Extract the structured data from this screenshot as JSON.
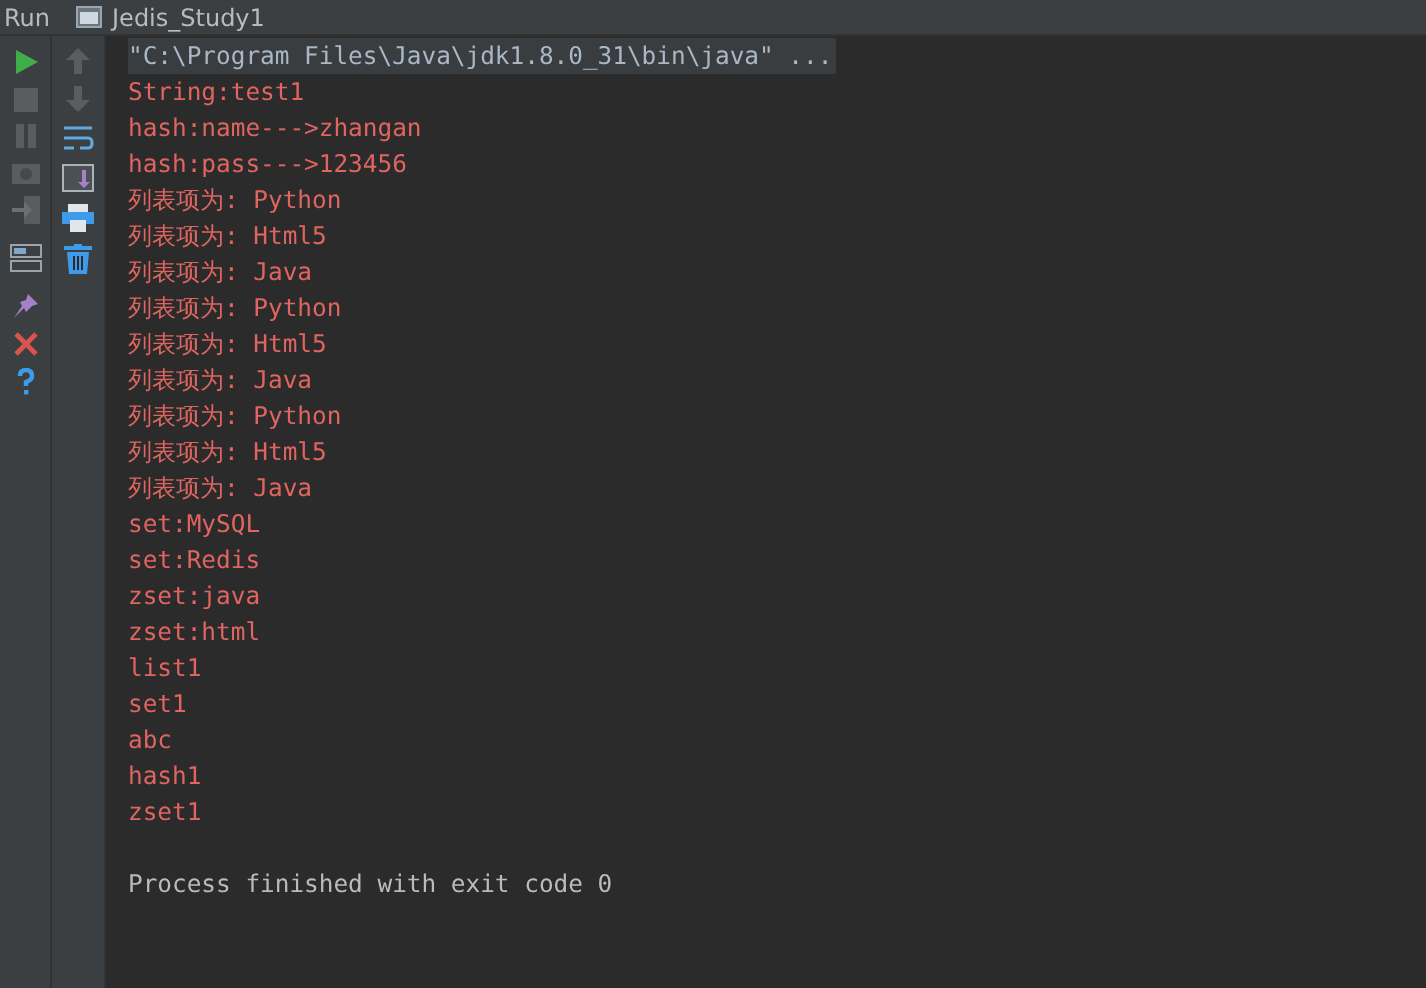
{
  "tool_window": {
    "label": "Run",
    "tab": "Jedis_Study1"
  },
  "console": [
    {
      "kind": "command",
      "text": "\"C:\\Program Files\\Java\\jdk1.8.0_31\\bin\\java\" ..."
    },
    {
      "kind": "output",
      "text": "String:test1"
    },
    {
      "kind": "output",
      "text": "hash:name--->zhangan"
    },
    {
      "kind": "output",
      "text": "hash:pass--->123456"
    },
    {
      "kind": "output",
      "text": "列表项为: Python"
    },
    {
      "kind": "output",
      "text": "列表项为: Html5"
    },
    {
      "kind": "output",
      "text": "列表项为: Java"
    },
    {
      "kind": "output",
      "text": "列表项为: Python"
    },
    {
      "kind": "output",
      "text": "列表项为: Html5"
    },
    {
      "kind": "output",
      "text": "列表项为: Java"
    },
    {
      "kind": "output",
      "text": "列表项为: Python"
    },
    {
      "kind": "output",
      "text": "列表项为: Html5"
    },
    {
      "kind": "output",
      "text": "列表项为: Java"
    },
    {
      "kind": "output",
      "text": "set:MySQL"
    },
    {
      "kind": "output",
      "text": "set:Redis"
    },
    {
      "kind": "output",
      "text": "zset:java"
    },
    {
      "kind": "output",
      "text": "zset:html"
    },
    {
      "kind": "output",
      "text": "list1"
    },
    {
      "kind": "output",
      "text": "set1"
    },
    {
      "kind": "output",
      "text": "abc"
    },
    {
      "kind": "output",
      "text": "hash1"
    },
    {
      "kind": "output",
      "text": "zset1"
    },
    {
      "kind": "system",
      "text": "Process finished with exit code 0"
    }
  ]
}
